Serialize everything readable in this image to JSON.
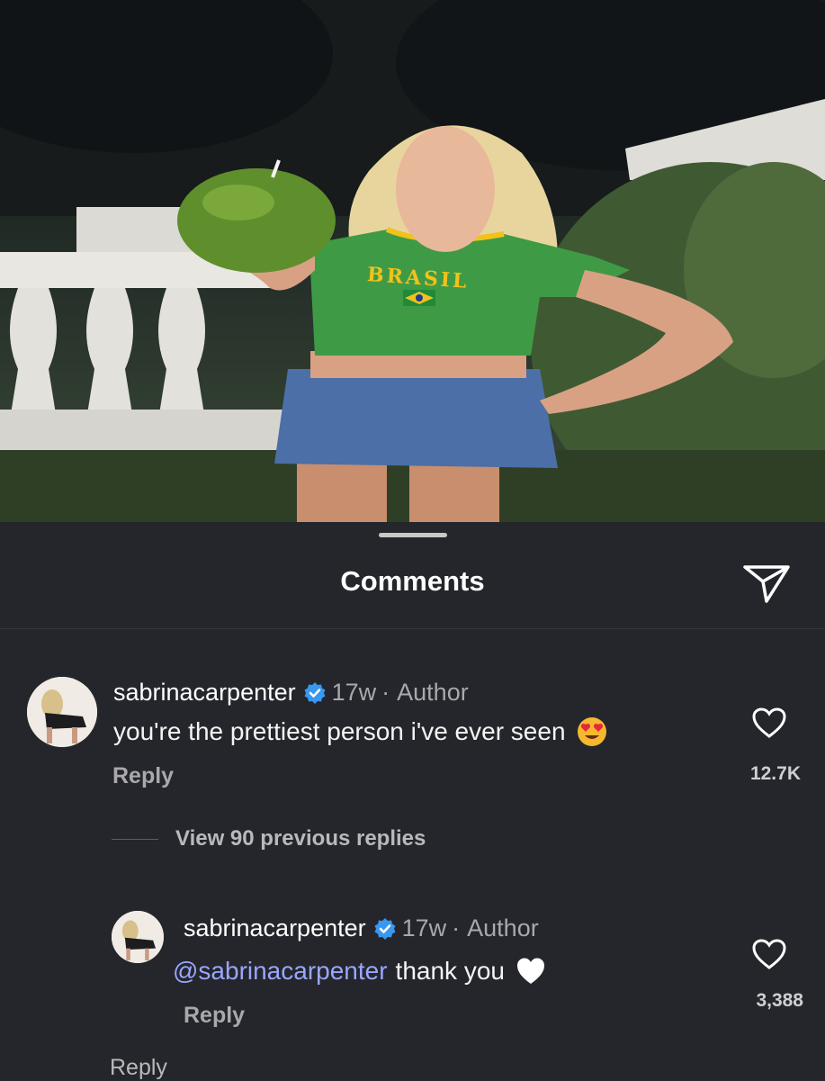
{
  "photo": {
    "shirt_text": "BRASIL"
  },
  "sheet": {
    "title": "Comments"
  },
  "comments": [
    {
      "username": "sabrinacarpenter",
      "time": "17w",
      "separator": "·",
      "role": "Author",
      "text": "you're the prettiest person i've ever seen",
      "emoji": "heart-eyes-emoji",
      "reply_label": "Reply",
      "likes": "12.7K"
    }
  ],
  "view_previous": "View 90 previous replies",
  "replies": [
    {
      "username": "sabrinacarpenter",
      "time": "17w",
      "separator": "·",
      "role": "Author",
      "mention": "@sabrinacarpenter",
      "text": "thank you",
      "emoji": "white-heart-emoji",
      "reply_label": "Reply",
      "likes": "3,388"
    }
  ],
  "bottom_reply_label": "Reply",
  "colors": {
    "background": "#24262b",
    "mention": "#9aa6ff",
    "verified": "#3897f0",
    "secondary_text": "#a8a8ad"
  }
}
